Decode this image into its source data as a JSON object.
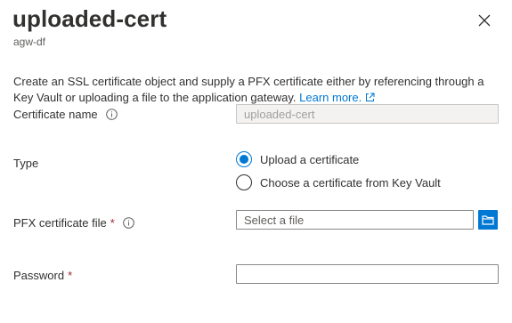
{
  "header": {
    "title": "uploaded-cert",
    "subtitle": "agw-df",
    "close_icon": "close-icon"
  },
  "description": {
    "text": "Create an SSL certificate object and supply a PFX certificate either by referencing through a Key Vault or uploading a file to the application gateway.",
    "link_text": "Learn more.",
    "link_icon": "external-link-icon"
  },
  "form": {
    "cert_name": {
      "label": "Certificate name",
      "value": "uploaded-cert",
      "disabled": true
    },
    "type": {
      "label": "Type",
      "options": [
        {
          "label": "Upload a certificate",
          "selected": true
        },
        {
          "label": "Choose a certificate from Key Vault",
          "selected": false
        }
      ]
    },
    "pfx_file": {
      "label": "PFX certificate file",
      "required_marker": "*",
      "placeholder": "Select a file",
      "browse_icon": "folder-icon"
    },
    "password": {
      "label": "Password",
      "required_marker": "*",
      "value": ""
    }
  },
  "colors": {
    "accent": "#0078d4",
    "required": "#a4262c",
    "text": "#323130",
    "muted": "#605e5c"
  }
}
